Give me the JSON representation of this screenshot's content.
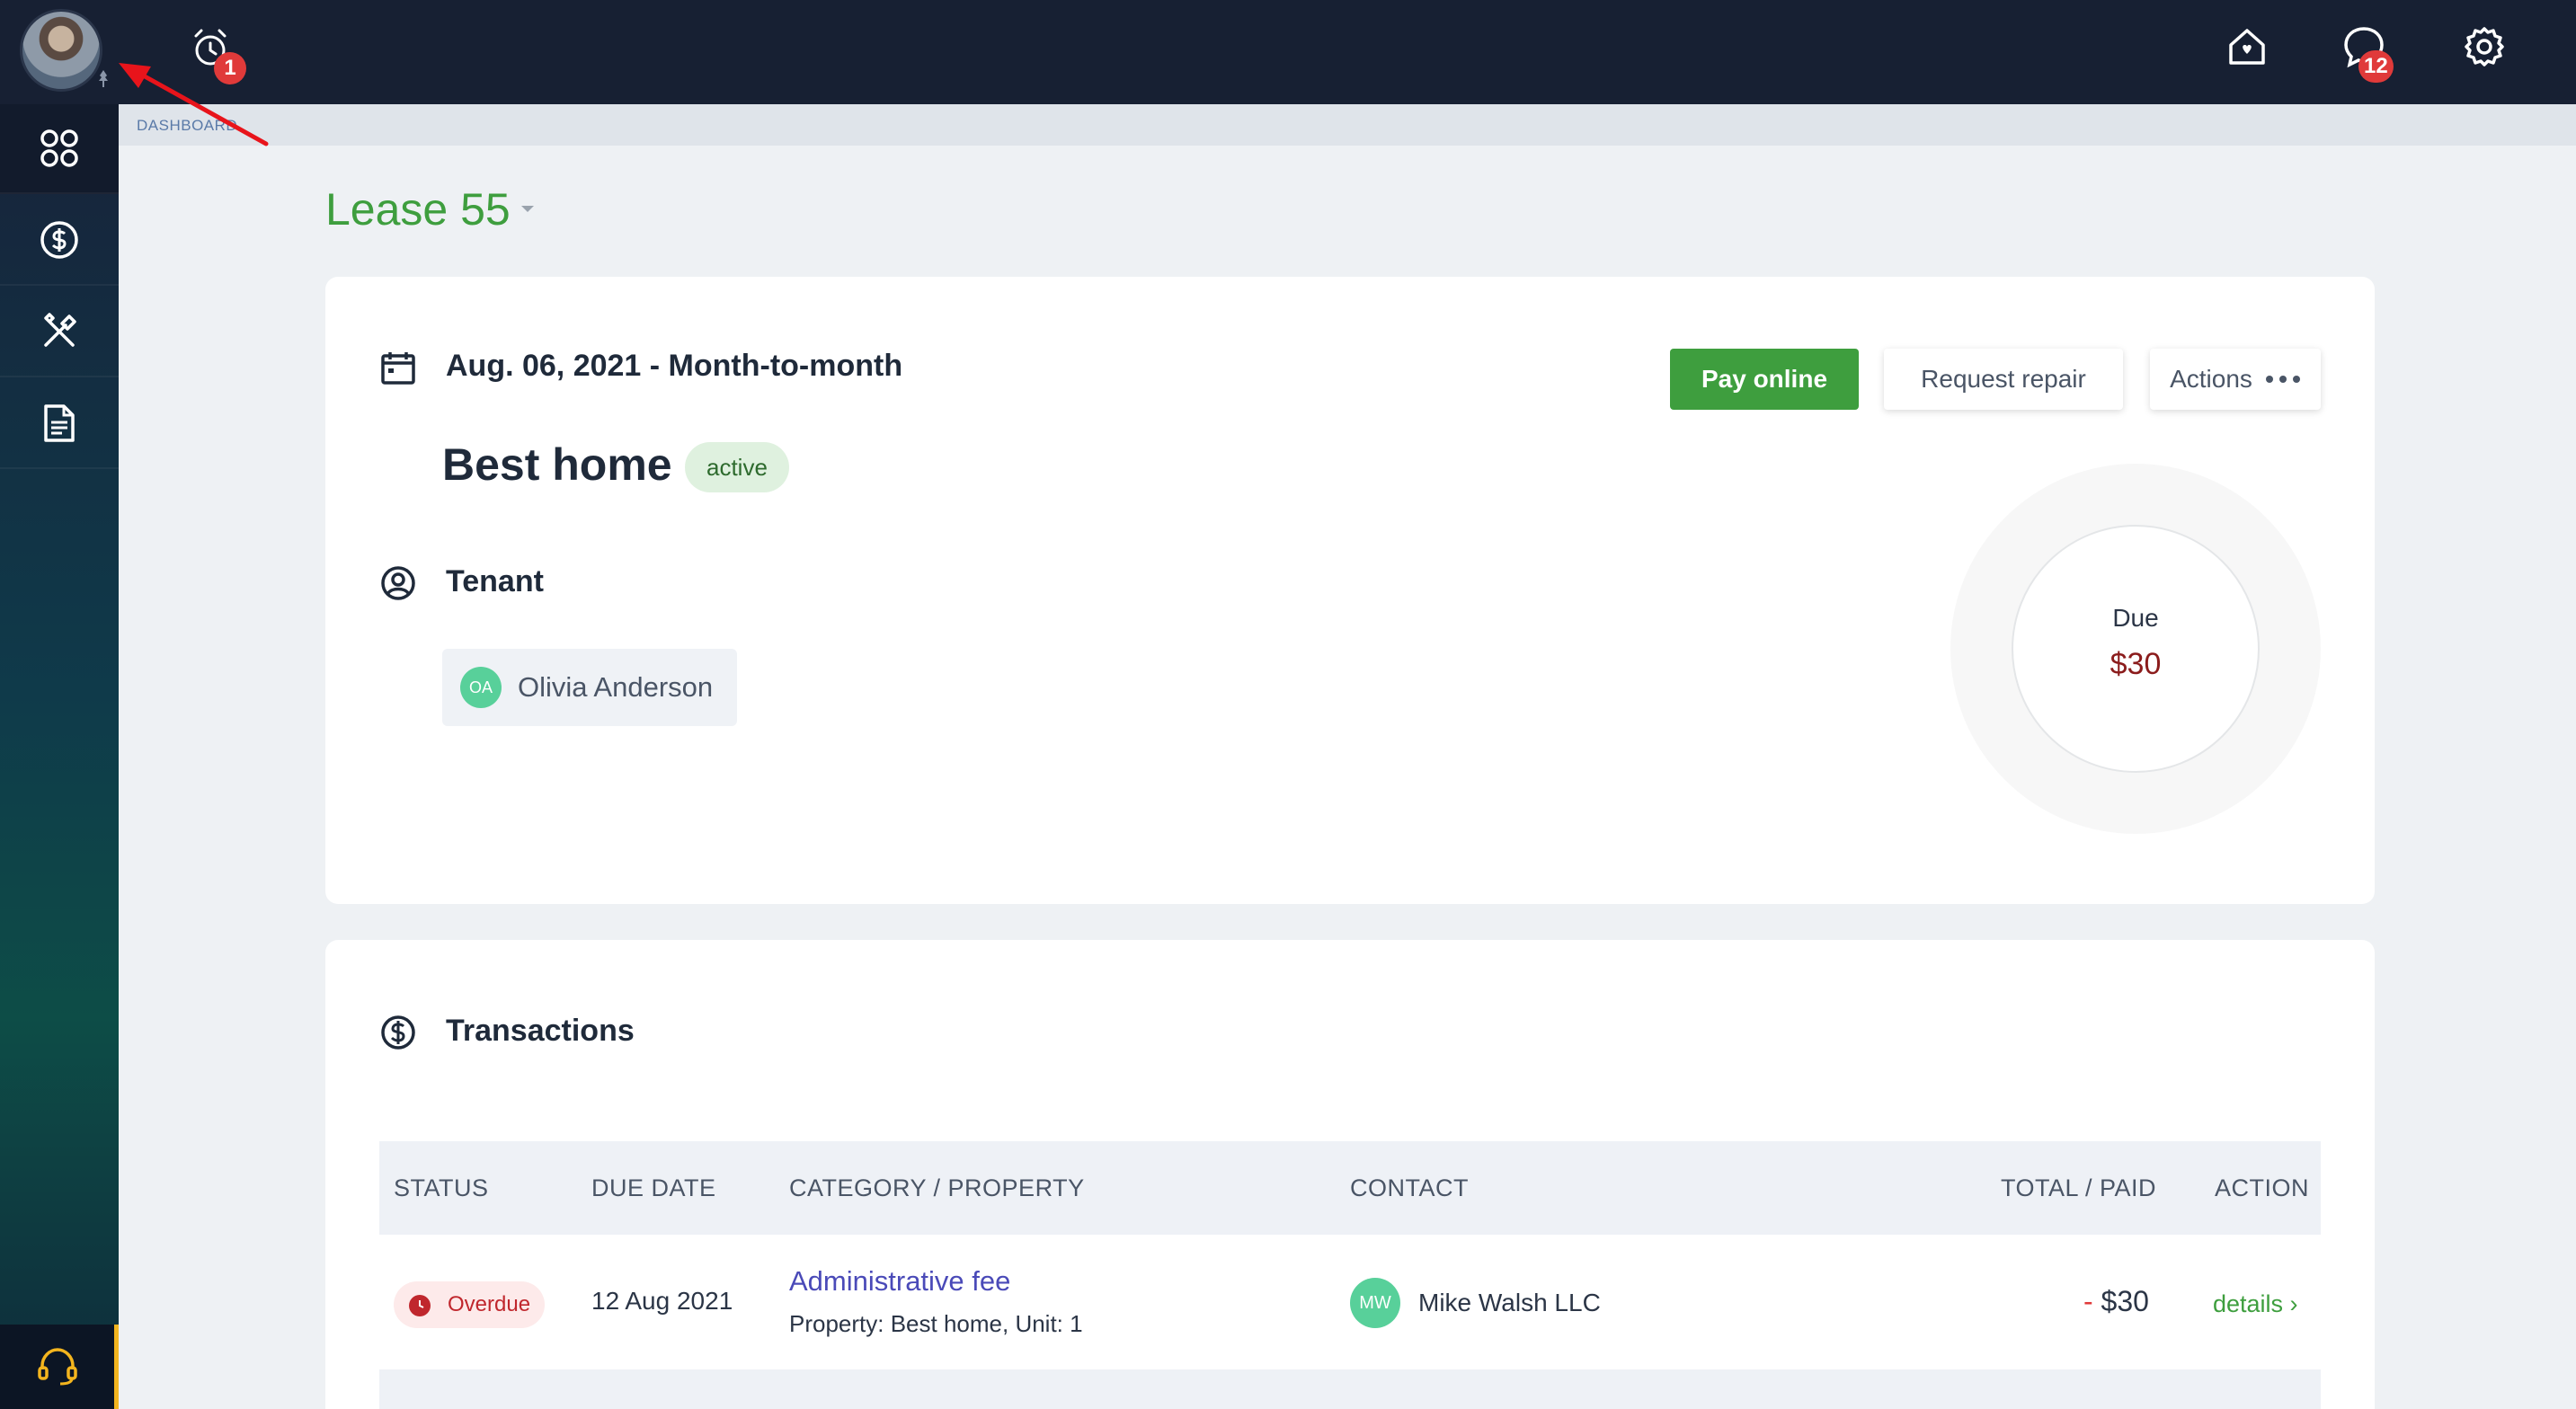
{
  "topbar": {
    "alarm_badge": "1",
    "messages_badge": "12",
    "icons": [
      "alarm-icon",
      "home-icon",
      "chat-icon",
      "gear-icon"
    ]
  },
  "sidebar": {
    "items": [
      "dashboard-icon",
      "payments-icon",
      "repairs-icon",
      "documents-icon"
    ],
    "support_icon": "headset-icon",
    "accent_color": "#f4b51e"
  },
  "breadcrumb": "DASHBOARD",
  "lease": {
    "title": "Lease 55",
    "dates": "Aug. 06, 2021 - Month-to-month",
    "property": "Best home",
    "status": "active",
    "tenant_label": "Tenant",
    "tenant": {
      "initials": "OA",
      "name": "Olivia Anderson"
    },
    "buttons": {
      "pay": "Pay online",
      "repair": "Request repair",
      "actions": "Actions"
    },
    "due": {
      "label": "Due",
      "amount": "$30"
    }
  },
  "transactions": {
    "title": "Transactions",
    "columns": [
      "STATUS",
      "DUE DATE",
      "CATEGORY / PROPERTY",
      "CONTACT",
      "TOTAL / PAID",
      "ACTION"
    ],
    "rows": [
      {
        "status": "Overdue",
        "due_date": "12 Aug 2021",
        "category": "Administrative fee",
        "property": "Property: Best home, Unit: 1",
        "contact_initials": "MW",
        "contact": "Mike Walsh LLC",
        "total_sign": "- ",
        "total": "$30",
        "action": "details ›"
      }
    ]
  },
  "colors": {
    "brand_green": "#3e9e3e",
    "nav_dark": "#172033",
    "overdue_red": "#c0272d"
  }
}
